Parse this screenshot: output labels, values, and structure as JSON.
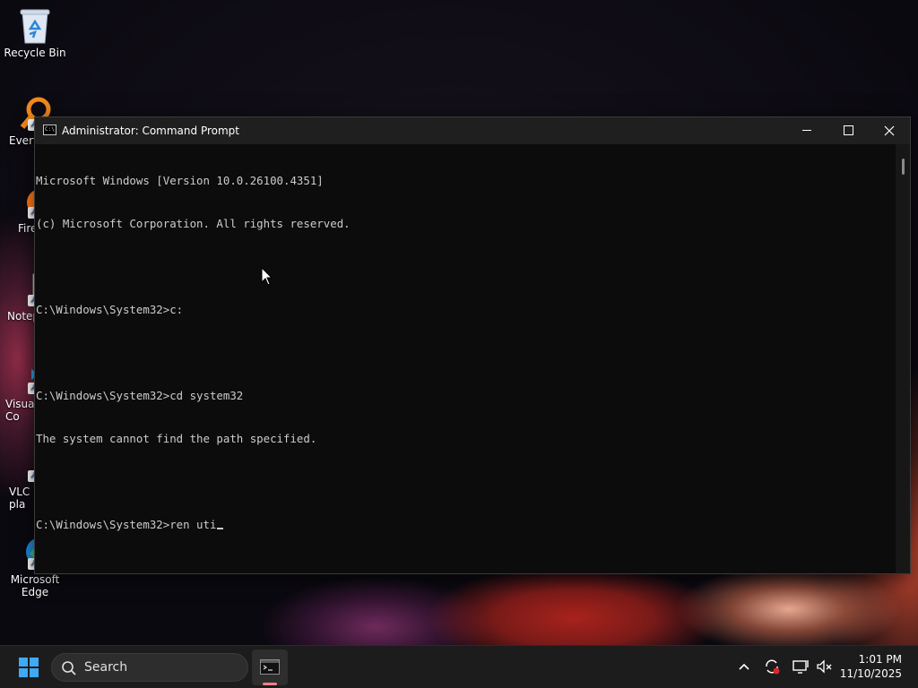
{
  "desktop": {
    "icons": [
      {
        "label": "Recycle Bin",
        "icon": "recycle-bin-icon"
      },
      {
        "label": "Every",
        "icon": "everything-search-icon"
      },
      {
        "label": "Firef",
        "icon": "firefox-icon"
      },
      {
        "label": "Notep",
        "icon": "notepad-plus-plus-icon"
      },
      {
        "label": "Visual\nCo",
        "icon": "vscode-icon"
      },
      {
        "label": "VLC r\npla",
        "icon": "vlc-icon"
      },
      {
        "label": "Microsoft\nEdge",
        "icon": "edge-icon"
      }
    ]
  },
  "window": {
    "title": "Administrator: Command Prompt",
    "icon": "cmd-icon",
    "lines": [
      "Microsoft Windows [Version 10.0.26100.4351]",
      "(c) Microsoft Corporation. All rights reserved.",
      "",
      "C:\\Windows\\System32>c:",
      "",
      "C:\\Windows\\System32>cd system32",
      "The system cannot find the path specified.",
      ""
    ],
    "prompt_line": "C:\\Windows\\System32>ren uti"
  },
  "taskbar": {
    "search_label": "Search",
    "pinned_app": "terminal-icon",
    "tray_icons": [
      "chevron-up-icon",
      "sync-icon",
      "display-icon",
      "volume-muted-icon"
    ],
    "time": "1:01 PM",
    "date": "11/10/2025"
  },
  "colors": {
    "console_bg": "#0c0c0c",
    "console_text": "#cccccc",
    "titlebar_bg": "#1f1f1f",
    "taskbar_bg": "#1c1c1c"
  }
}
